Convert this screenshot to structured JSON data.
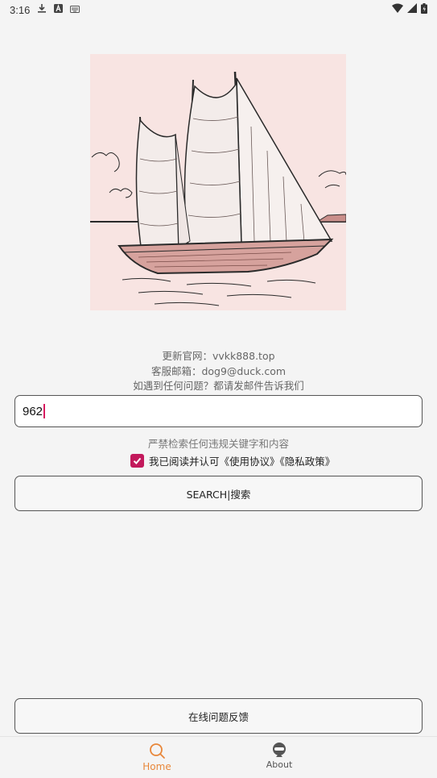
{
  "status_bar": {
    "time": "3:16",
    "icons_left": [
      "download-icon",
      "a-icon",
      "keyboard-icon"
    ],
    "icons_right": [
      "wifi-icon",
      "signal-icon",
      "battery-icon"
    ]
  },
  "info": {
    "line1": "更新官网：vvkk888.top",
    "line2": "客服邮箱：dog9@duck.com",
    "line3": "如遇到任何问题？都请发邮件告诉我们"
  },
  "search": {
    "value": "962"
  },
  "warning": "严禁检索任何违规关键字和内容",
  "agreement": {
    "checked": true,
    "text": "我已阅读并认可《使用协议》《隐私政策》"
  },
  "buttons": {
    "search": "SEARCH|搜索",
    "feedback": "在线问题反馈"
  },
  "nav": {
    "home": "Home",
    "about": "About"
  },
  "colors": {
    "accent": "#c2185b",
    "nav_active": "#e8873a"
  }
}
